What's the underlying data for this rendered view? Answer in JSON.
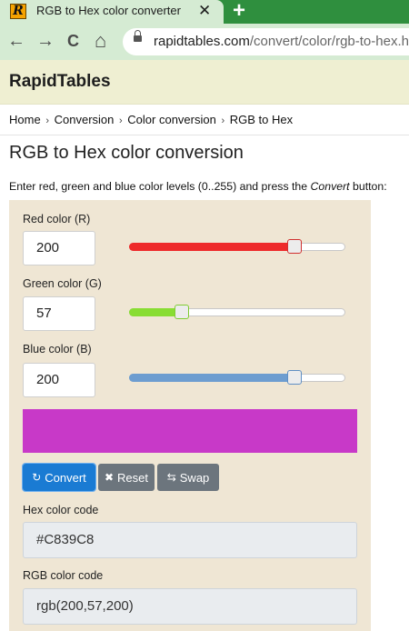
{
  "browser": {
    "tab_favicon": "R",
    "tab_title": "RGB to Hex color converter",
    "tab_close": "✕",
    "new_tab": "+",
    "back_icon": "←",
    "forward_icon": "→",
    "reload_icon": "C",
    "home_icon": "⌂",
    "url_host": "rapidtables.com",
    "url_path": "/convert/color/rgb-to-hex.htm"
  },
  "site": {
    "logo": "RapidTables"
  },
  "breadcrumb": [
    {
      "label": "Home"
    },
    {
      "label": "Conversion"
    },
    {
      "label": "Color conversion"
    },
    {
      "label": "RGB to Hex"
    }
  ],
  "breadcrumb_separator": "›",
  "page": {
    "title": "RGB to Hex color conversion",
    "instructions_prefix": "Enter red, green and blue color levels (0..255) and press the ",
    "instructions_emph": "Convert",
    "instructions_suffix": " button:"
  },
  "form": {
    "red": {
      "label": "Red color (R)",
      "value": "200",
      "slider_value": 200,
      "slider_max": 255,
      "fill_color": "#ee2a2a",
      "thumb_border": "#d03030"
    },
    "green": {
      "label": "Green color (G)",
      "value": "57",
      "slider_value": 57,
      "slider_max": 255,
      "fill_color": "#88dd33",
      "thumb_border": "#7fcc33"
    },
    "blue": {
      "label": "Blue color (B)",
      "value": "200",
      "slider_value": 200,
      "slider_max": 255,
      "fill_color": "#6d9dd0",
      "thumb_border": "#5f8fc4"
    },
    "preview_color": "#C839C8"
  },
  "buttons": {
    "convert": {
      "icon": "↻",
      "label": "Convert"
    },
    "reset": {
      "icon": "✖",
      "label": "Reset"
    },
    "swap": {
      "icon": "⇆",
      "label": "Swap"
    }
  },
  "outputs": {
    "hex_label": "Hex color code",
    "hex_value": "#C839C8",
    "rgb_label": "RGB color code",
    "rgb_value": "rgb(200,57,200)"
  }
}
